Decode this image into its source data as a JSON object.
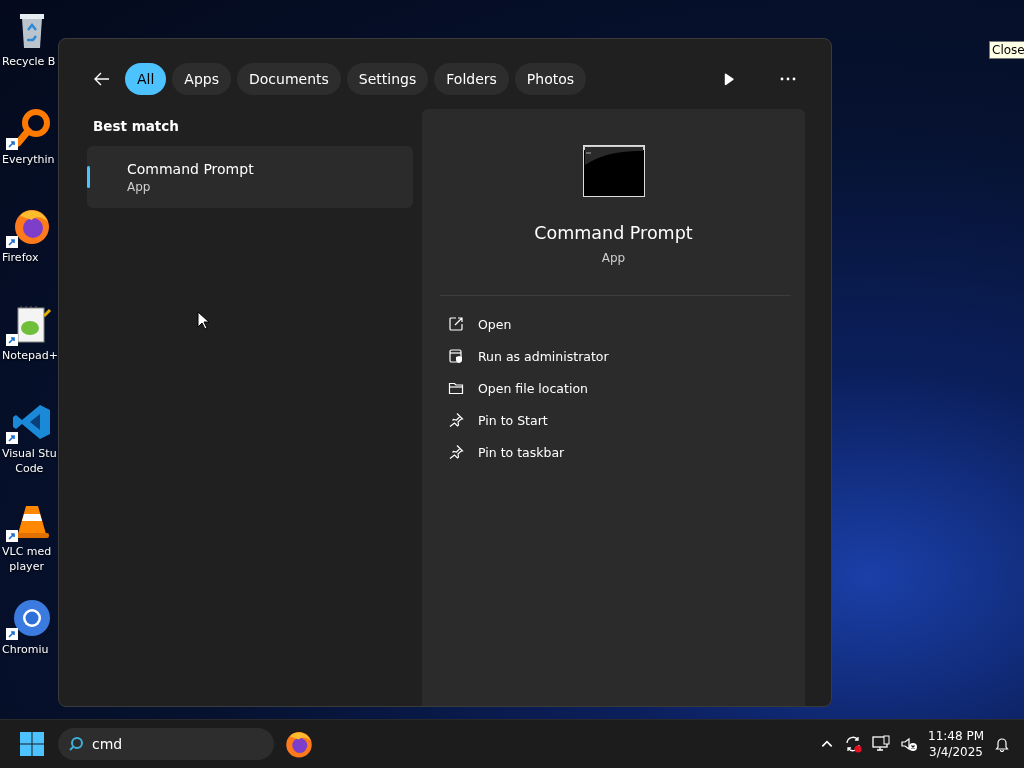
{
  "desktop_icons": [
    {
      "kind": "recycle",
      "label": "Recycle B",
      "shortcut": false
    },
    {
      "kind": "everything",
      "label": "Everythin",
      "shortcut": true
    },
    {
      "kind": "firefox",
      "label": "Firefox",
      "shortcut": true
    },
    {
      "kind": "notepad",
      "label": "Notepad+",
      "shortcut": true
    },
    {
      "kind": "vscode",
      "label": "Visual Stu\nCode",
      "shortcut": true
    },
    {
      "kind": "vlc",
      "label": "VLC med\nplayer",
      "shortcut": true
    },
    {
      "kind": "chromium",
      "label": "Chromiu",
      "shortcut": true
    }
  ],
  "search_panel": {
    "filters": [
      {
        "label": "All",
        "selected": true
      },
      {
        "label": "Apps",
        "selected": false
      },
      {
        "label": "Documents",
        "selected": false
      },
      {
        "label": "Settings",
        "selected": false
      },
      {
        "label": "Folders",
        "selected": false
      },
      {
        "label": "Photos",
        "selected": false
      }
    ],
    "best_match_heading": "Best match",
    "results": [
      {
        "title": "Command Prompt",
        "subtitle": "App",
        "selected": true
      }
    ],
    "preview": {
      "title": "Command Prompt",
      "subtitle": "App"
    },
    "actions": [
      {
        "kind": "open",
        "label": "Open"
      },
      {
        "kind": "admin",
        "label": "Run as administrator"
      },
      {
        "kind": "folder",
        "label": "Open file location"
      },
      {
        "kind": "pin",
        "label": "Pin to Start"
      },
      {
        "kind": "pin",
        "label": "Pin to taskbar"
      }
    ]
  },
  "tooltip": "Close",
  "taskbar": {
    "search_value": "cmd",
    "time": "11:48 PM",
    "date": "3/4/2025"
  }
}
